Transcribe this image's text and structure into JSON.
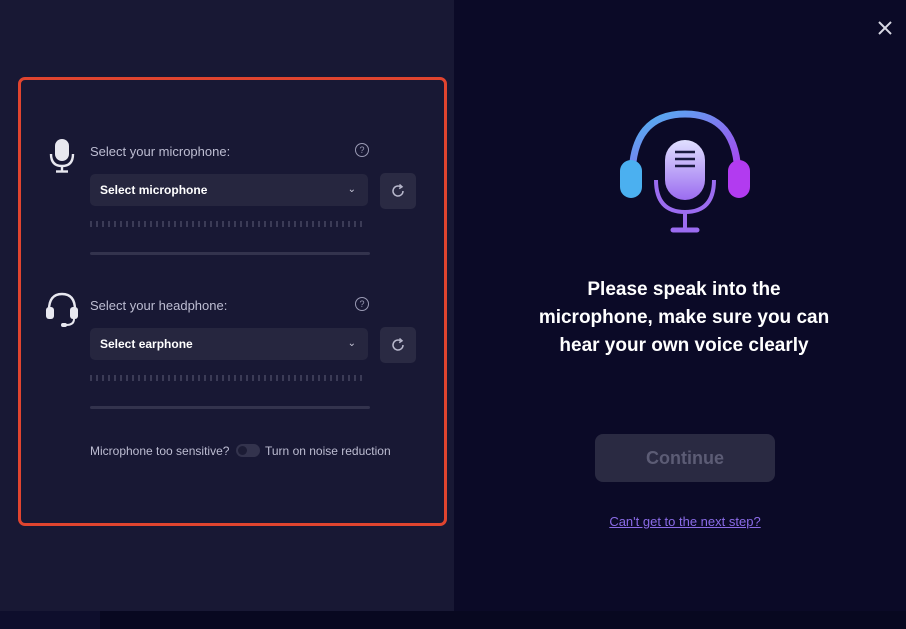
{
  "mic_section": {
    "label": "Select your microphone:",
    "help": "?",
    "select_value": "Select microphone"
  },
  "headphone_section": {
    "label": "Select your headphone:",
    "help": "?",
    "select_value": "Select earphone"
  },
  "noise": {
    "question": "Microphone too sensitive?",
    "toggle_label": "Turn on noise reduction",
    "enabled": false
  },
  "hero": {
    "title": "Please speak into the microphone, make sure you can hear your own voice clearly"
  },
  "continue_label": "Continue",
  "help_link": "Can't get to the next step?",
  "icons": {
    "mic": "microphone-icon",
    "headphone": "headset-icon",
    "refresh": "refresh-icon",
    "close": "close-icon",
    "hero": "headphones-microphone-icon",
    "chevron": "chevron-down-icon"
  },
  "colors": {
    "highlight_border": "#e0442f",
    "accent": "#8b6ce8",
    "gradient_start": "#4bb8f0",
    "gradient_end": "#b23bf0"
  }
}
